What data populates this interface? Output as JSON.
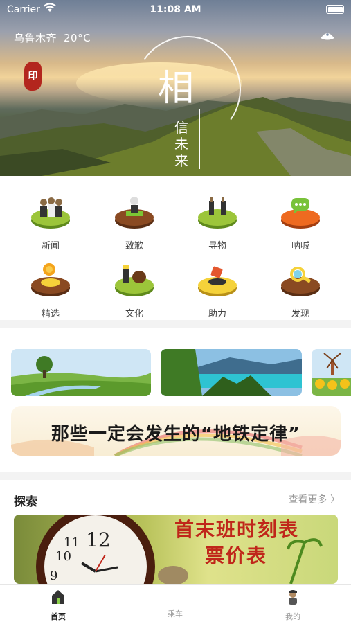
{
  "status_bar": {
    "carrier": "Carrier",
    "time": "11:08 AM"
  },
  "header": {
    "city": "乌鲁木齐",
    "temperature": "20°C",
    "logo_main": "相",
    "logo_sub": "信未来"
  },
  "grid": [
    {
      "label": "新闻",
      "icon": "people-icon"
    },
    {
      "label": "致歉",
      "icon": "apology-icon"
    },
    {
      "label": "寻物",
      "icon": "plug-icon"
    },
    {
      "label": "呐喊",
      "icon": "chat-bubble-icon"
    },
    {
      "label": "精选",
      "icon": "medal-icon"
    },
    {
      "label": "文化",
      "icon": "culture-icon"
    },
    {
      "label": "助力",
      "icon": "help-icon"
    },
    {
      "label": "发现",
      "icon": "magnifier-icon"
    }
  ],
  "banner": {
    "metro_title": "那些一定会发生的“地铁定律”"
  },
  "explore": {
    "title": "探索",
    "more": "查看更多 〉",
    "card_line1": "首末班时刻表",
    "card_line2": "票价表"
  },
  "tabbar": [
    {
      "label": "首页",
      "icon": "home-icon",
      "active": true
    },
    {
      "label": "乘车",
      "icon": "ride-icon",
      "active": false
    },
    {
      "label": "我的",
      "icon": "profile-icon",
      "active": false
    }
  ],
  "colors": {
    "accent": "#222222",
    "inactive": "#999999",
    "brand_red": "#c0261a"
  }
}
